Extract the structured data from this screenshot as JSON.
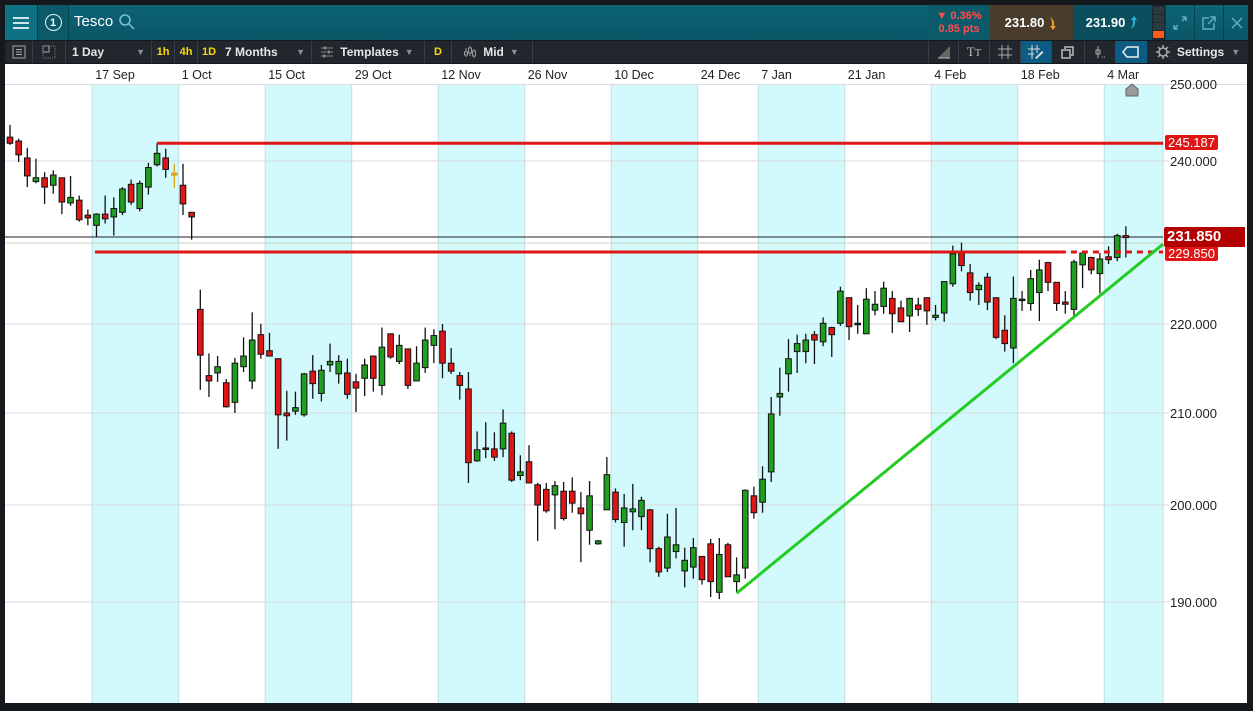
{
  "header": {
    "menu_icon": "hamburger-icon",
    "instance_number": "1",
    "title": "Tesco",
    "change_percent": "▼ 0.36%",
    "change_points": "0.85 pts",
    "bid": "231.80",
    "ask": "231.90",
    "colors": {
      "bid_bg": "#4a3c2c",
      "ask_bg": "#0b4f5e",
      "change": "#ff4d4d"
    }
  },
  "toolbar": {
    "interval": "1 Day",
    "quick_intervals": [
      "1h",
      "4h",
      "1D"
    ],
    "range": "7 Months",
    "templates": "Templates",
    "d_button": "D",
    "price_type": "Mid",
    "settings": "Settings"
  },
  "chart_data": {
    "type": "candlestick",
    "title": "Tesco",
    "interval": "1 Day",
    "y_axis": {
      "scale": "price",
      "ticks": [
        "250.000",
        "240.000",
        "220.000",
        "210.000",
        "200.000",
        "190.000"
      ],
      "tick_values": [
        250,
        240,
        220,
        210,
        200,
        190
      ],
      "ylim": [
        182,
        252
      ]
    },
    "x_axis": {
      "ticks": [
        {
          "label": "17 Sep",
          "index": 11
        },
        {
          "label": "1 Oct",
          "index": 21
        },
        {
          "label": "15 Oct",
          "index": 31
        },
        {
          "label": "29 Oct",
          "index": 41
        },
        {
          "label": "12 Nov",
          "index": 51
        },
        {
          "label": "26 Nov",
          "index": 61
        },
        {
          "label": "10 Dec",
          "index": 71
        },
        {
          "label": "24 Dec",
          "index": 81
        },
        {
          "label": "7 Jan",
          "index": 88
        },
        {
          "label": "21 Jan",
          "index": 98
        },
        {
          "label": "4 Feb",
          "index": 108
        },
        {
          "label": "18 Feb",
          "index": 118
        },
        {
          "label": "4 Mar",
          "index": 128
        }
      ]
    },
    "grid": true,
    "colors": {
      "up": "#1f9e1f",
      "down": "#e01515",
      "doji_highlight": "#d9a21b",
      "resistance": "#e01515",
      "trendline": "#22cc22",
      "current_price": "#b30000"
    },
    "ohlc": [
      [
        243.1,
        244.7,
        242.1,
        242.3
      ],
      [
        242.6,
        242.9,
        239.9,
        240.8
      ],
      [
        240.4,
        241.7,
        237.2,
        238.4
      ],
      [
        237.8,
        240.3,
        237.6,
        238.2
      ],
      [
        238.2,
        238.8,
        235.4,
        237.2
      ],
      [
        237.4,
        239.0,
        236.5,
        238.5
      ],
      [
        238.2,
        238.2,
        234.3,
        235.6
      ],
      [
        235.5,
        238.4,
        235.2,
        236.1
      ],
      [
        235.8,
        236.3,
        233.5,
        233.7
      ],
      [
        234.2,
        234.8,
        233.1,
        233.9
      ],
      [
        233.1,
        234.4,
        231.8,
        234.3
      ],
      [
        234.3,
        236.3,
        233.3,
        233.8
      ],
      [
        234.0,
        236.1,
        232.0,
        234.9
      ],
      [
        234.5,
        237.2,
        234.2,
        237.0
      ],
      [
        237.5,
        238.0,
        235.3,
        235.6
      ],
      [
        234.9,
        237.9,
        234.6,
        237.6
      ],
      [
        237.2,
        239.8,
        236.4,
        239.3
      ],
      [
        239.6,
        242.3,
        239.4,
        241.0
      ],
      [
        240.4,
        241.6,
        238.2,
        239.1
      ],
      [
        238.7,
        239.7,
        237.1,
        238.6
      ],
      [
        237.4,
        239.7,
        234.2,
        235.4
      ],
      [
        234.5,
        234.5,
        231.5,
        234.0
      ],
      [
        222.0,
        224.7,
        212.6,
        216.5
      ],
      [
        214.2,
        216.7,
        211.8,
        213.6
      ],
      [
        214.5,
        216.4,
        213.5,
        215.2
      ],
      [
        213.4,
        213.8,
        210.6,
        210.7
      ],
      [
        211.2,
        216.2,
        210.0,
        215.6
      ],
      [
        215.2,
        218.5,
        214.6,
        216.4
      ],
      [
        213.6,
        221.6,
        212.7,
        218.2
      ],
      [
        218.8,
        220.0,
        216.1,
        216.6
      ],
      [
        217.0,
        219.0,
        216.4,
        216.4
      ],
      [
        216.1,
        216.1,
        206.1,
        209.8
      ],
      [
        210.0,
        212.5,
        207.0,
        209.7
      ],
      [
        210.2,
        212.4,
        209.8,
        210.6
      ],
      [
        209.8,
        214.5,
        209.6,
        214.4
      ],
      [
        214.7,
        216.5,
        211.6,
        213.3
      ],
      [
        212.2,
        215.4,
        211.3,
        214.8
      ],
      [
        215.4,
        217.8,
        214.6,
        215.8
      ],
      [
        214.4,
        216.5,
        213.3,
        215.8
      ],
      [
        214.5,
        216.1,
        211.6,
        212.1
      ],
      [
        213.5,
        214.4,
        210.1,
        212.8
      ],
      [
        213.9,
        216.1,
        211.9,
        215.4
      ],
      [
        216.4,
        216.4,
        212.4,
        213.9
      ],
      [
        213.1,
        219.6,
        212.0,
        217.4
      ],
      [
        218.9,
        218.9,
        216.1,
        216.3
      ],
      [
        215.8,
        218.8,
        215.5,
        217.6
      ],
      [
        217.2,
        217.2,
        212.7,
        213.1
      ],
      [
        213.6,
        217.5,
        213.6,
        215.6
      ],
      [
        215.1,
        219.6,
        214.5,
        218.2
      ],
      [
        217.6,
        219.4,
        215.6,
        218.7
      ],
      [
        219.2,
        220.0,
        213.9,
        215.6
      ],
      [
        215.6,
        217.3,
        214.4,
        214.7
      ],
      [
        214.2,
        214.6,
        211.5,
        213.1
      ],
      [
        212.7,
        214.6,
        202.4,
        204.6
      ],
      [
        204.8,
        208.0,
        204.7,
        206.0
      ],
      [
        206.2,
        209.0,
        205.1,
        206.2
      ],
      [
        206.1,
        207.9,
        204.8,
        205.2
      ],
      [
        206.1,
        210.4,
        205.2,
        208.9
      ],
      [
        207.8,
        208.0,
        202.5,
        202.7
      ],
      [
        203.2,
        205.4,
        202.7,
        203.6
      ],
      [
        204.7,
        206.5,
        202.4,
        202.4
      ],
      [
        202.2,
        202.4,
        196.3,
        200.0
      ],
      [
        201.7,
        202.4,
        199.2,
        199.4
      ],
      [
        201.1,
        202.6,
        197.5,
        202.1
      ],
      [
        201.5,
        202.5,
        198.4,
        198.6
      ],
      [
        201.5,
        203.0,
        199.2,
        200.2
      ],
      [
        199.7,
        201.4,
        194.1,
        199.1
      ],
      [
        197.4,
        202.6,
        195.9,
        201.0
      ],
      [
        196.0,
        196.4,
        195.9,
        196.3
      ],
      [
        199.5,
        205.2,
        199.5,
        203.3
      ],
      [
        201.4,
        201.8,
        198.2,
        198.5
      ],
      [
        198.2,
        201.2,
        195.7,
        199.7
      ],
      [
        199.3,
        202.3,
        197.4,
        199.6
      ],
      [
        198.8,
        200.9,
        197.4,
        200.5
      ],
      [
        199.5,
        199.6,
        194.1,
        195.5
      ],
      [
        195.5,
        195.7,
        192.6,
        193.1
      ],
      [
        193.5,
        199.1,
        193.1,
        196.7
      ],
      [
        195.2,
        199.7,
        194.5,
        195.9
      ],
      [
        193.2,
        195.6,
        191.5,
        194.3
      ],
      [
        193.6,
        196.6,
        192.4,
        195.6
      ],
      [
        194.7,
        194.7,
        191.8,
        192.3
      ],
      [
        196.0,
        196.5,
        190.5,
        192.1
      ],
      [
        191.0,
        196.6,
        190.3,
        194.9
      ],
      [
        195.9,
        196.1,
        192.6,
        192.6
      ],
      [
        192.1,
        194.6,
        191.0,
        192.8
      ],
      [
        193.5,
        201.7,
        192.4,
        201.6
      ],
      [
        201.0,
        202.0,
        198.6,
        199.2
      ],
      [
        200.3,
        204.2,
        199.2,
        202.8
      ],
      [
        203.6,
        211.8,
        202.5,
        209.9
      ],
      [
        211.8,
        215.1,
        209.7,
        212.2
      ],
      [
        214.4,
        218.3,
        212.4,
        216.1
      ],
      [
        216.9,
        218.8,
        214.5,
        217.8
      ],
      [
        216.9,
        218.9,
        215.6,
        218.2
      ],
      [
        218.8,
        219.2,
        215.5,
        218.2
      ],
      [
        218.0,
        220.9,
        217.5,
        220.1
      ],
      [
        219.6,
        219.7,
        216.3,
        218.8
      ],
      [
        220.1,
        225.1,
        219.8,
        224.5
      ],
      [
        223.6,
        223.6,
        218.2,
        219.7
      ],
      [
        220.1,
        222.6,
        218.9,
        220.1
      ],
      [
        218.9,
        224.9,
        218.9,
        223.4
      ],
      [
        221.9,
        224.5,
        221.2,
        222.7
      ],
      [
        222.4,
        225.8,
        221.4,
        224.9
      ],
      [
        223.5,
        224.5,
        219.0,
        221.4
      ],
      [
        222.2,
        223.2,
        220.3,
        220.3
      ],
      [
        221.1,
        223.6,
        219.1,
        223.5
      ],
      [
        222.6,
        223.6,
        221.1,
        222.0
      ],
      [
        223.6,
        223.6,
        219.9,
        221.8
      ],
      [
        220.9,
        222.6,
        220.5,
        221.2
      ],
      [
        221.5,
        225.8,
        220.3,
        225.8
      ],
      [
        225.5,
        230.7,
        225.1,
        229.6
      ],
      [
        229.7,
        231.1,
        227.2,
        228.0
      ],
      [
        227.0,
        228.2,
        223.2,
        224.3
      ],
      [
        224.7,
        225.7,
        222.6,
        225.3
      ],
      [
        226.4,
        227.0,
        221.9,
        223.0
      ],
      [
        223.6,
        223.6,
        218.3,
        218.5
      ],
      [
        219.3,
        221.2,
        216.9,
        217.8
      ],
      [
        217.3,
        226.5,
        215.6,
        223.5
      ],
      [
        223.4,
        224.5,
        221.8,
        223.4
      ],
      [
        222.8,
        227.4,
        221.8,
        226.2
      ],
      [
        224.3,
        228.8,
        220.4,
        227.4
      ],
      [
        228.4,
        228.5,
        224.5,
        225.7
      ],
      [
        225.7,
        225.7,
        221.8,
        222.8
      ],
      [
        223.0,
        224.5,
        221.4,
        222.7
      ],
      [
        222.0,
        228.8,
        221.1,
        228.5
      ],
      [
        228.1,
        229.7,
        224.9,
        229.7
      ],
      [
        229.1,
        229.2,
        226.8,
        227.4
      ],
      [
        226.9,
        229.7,
        224.2,
        228.9
      ],
      [
        229.2,
        230.6,
        228.2,
        228.8
      ],
      [
        229.1,
        232.2,
        228.6,
        232.0
      ],
      [
        232.0,
        233.0,
        229.1,
        231.85
      ]
    ],
    "highlighted_doji_index": 20,
    "annotations": {
      "resistance_line": {
        "label": "245.187",
        "start_candle": 18
      },
      "support_line": {
        "label": "229.850",
        "price": 229.85,
        "start_candle": 11,
        "dashed_from_candle": 127
      },
      "current_price": {
        "label": "231.850",
        "price": 231.85
      },
      "trendline": {
        "start": [
          85,
          190.9
        ],
        "end": [
          134.3,
          230.9
        ]
      }
    }
  }
}
